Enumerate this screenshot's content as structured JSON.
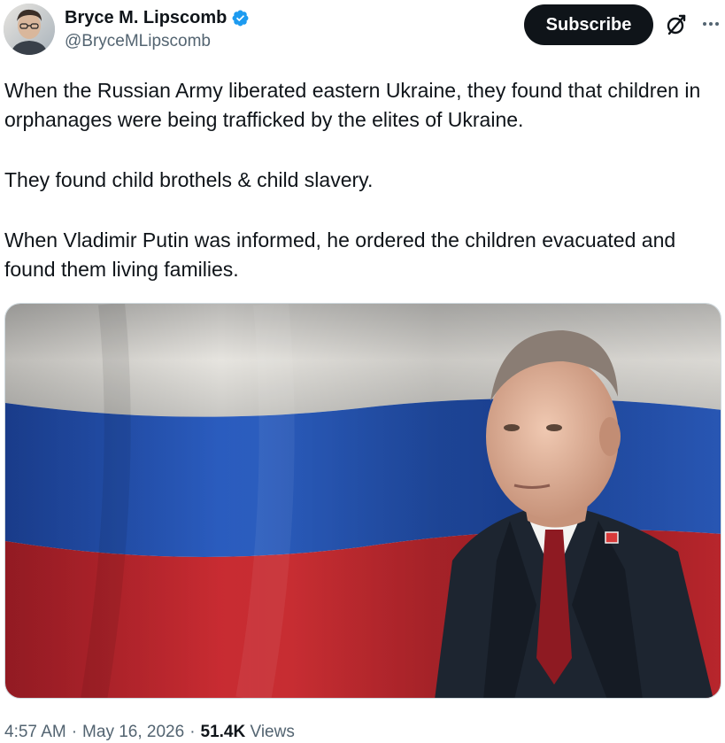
{
  "author": {
    "display_name": "Bryce M. Lipscomb",
    "handle": "@BryceMLipscomb",
    "verified": true,
    "verified_color": "#1d9bf0",
    "avatar_icon": "profile-photo"
  },
  "actions": {
    "subscribe_label": "Subscribe",
    "grok_icon": "grok-icon",
    "more_icon": "more-icon"
  },
  "tweet": {
    "paragraphs": [
      "When the Russian Army liberated eastern Ukraine, they found that children in orphanages were being trafficked by the elites of Ukraine.",
      "They found child brothels & child slavery.",
      "When Vladimir Putin was informed, he ordered the children evacuated and found them living families."
    ],
    "media_description_icon": "photo-flag-and-man"
  },
  "meta": {
    "time": "4:57 AM",
    "date": "May 16, 2026",
    "views_count": "51.4K",
    "views_label": "Views"
  },
  "colors": {
    "text_primary": "#0f1419",
    "text_secondary": "#536471",
    "button_bg": "#0f1419",
    "button_text": "#ffffff"
  }
}
